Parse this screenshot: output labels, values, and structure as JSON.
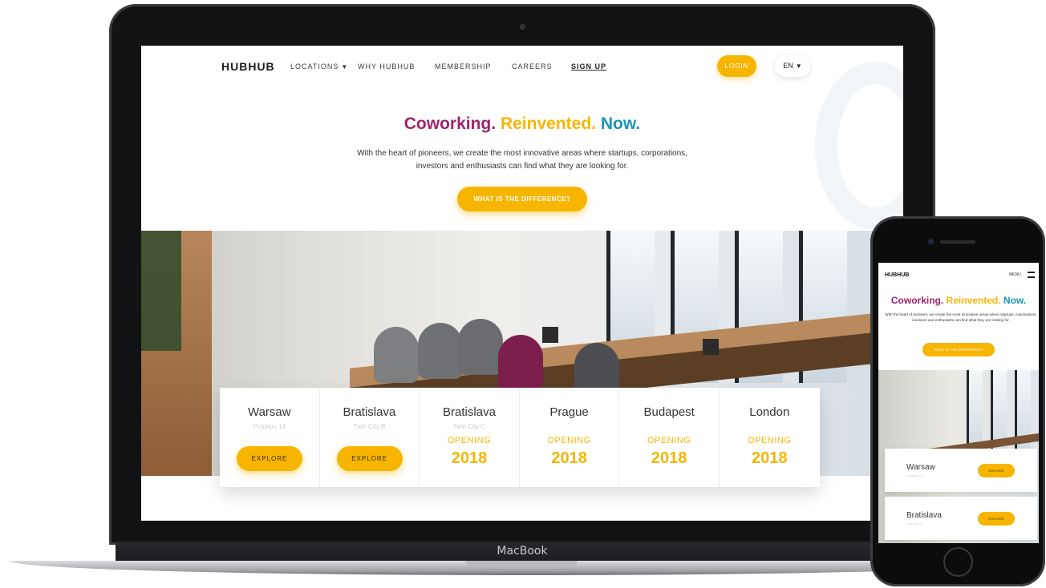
{
  "laptop": {
    "brand": "MacBook"
  },
  "site": {
    "logo": "HUBHUB",
    "nav": {
      "locations": "LOCATIONS",
      "why": "WHY HUBHUB",
      "membership": "MEMBERSHIP",
      "careers": "CAREERS",
      "signup": "SIGN UP",
      "login": "LOGIN",
      "lang": "EN"
    },
    "hero": {
      "title_part1": "Coworking.",
      "title_part2": "Reinvented.",
      "title_part3": "Now.",
      "text": "With the heart of pioneers, we create the most innovative areas where startups, corporations, investors and enthusiasts can find what they are looking for.",
      "cta": "WHAT IS THE DIFFERENCE?"
    },
    "locations": [
      {
        "city": "Warsaw",
        "address": "Postepu 14",
        "action": "EXPLORE"
      },
      {
        "city": "Bratislava",
        "address": "Twin City B",
        "action": "EXPLORE"
      },
      {
        "city": "Bratislava",
        "address": "Twin City C",
        "status": "OPENING",
        "year": "2018"
      },
      {
        "city": "Prague",
        "status": "OPENING",
        "year": "2018"
      },
      {
        "city": "Budapest",
        "status": "OPENING",
        "year": "2018"
      },
      {
        "city": "London",
        "status": "OPENING",
        "year": "2018"
      }
    ]
  },
  "phone": {
    "logo": "HUBHUB",
    "menu": "MENU",
    "title_part1": "Coworking.",
    "title_part2": "Reinvented.",
    "title_part3": "Now.",
    "text": "With the heart of pioneers, we create the most innovative areas where startups, corporations, investors and enthusiasts can find what they are looking for.",
    "cta": "WHAT IS THE DIFFERENCE?",
    "locations": [
      {
        "city": "Warsaw",
        "address": "Postepu 14",
        "action": "EXPLORE"
      },
      {
        "city": "Bratislava",
        "address": "Twin City B",
        "action": "EXPLORE"
      }
    ]
  },
  "colors": {
    "accent": "#f7b500",
    "magenta": "#a0226f",
    "teal": "#1a96b5"
  }
}
